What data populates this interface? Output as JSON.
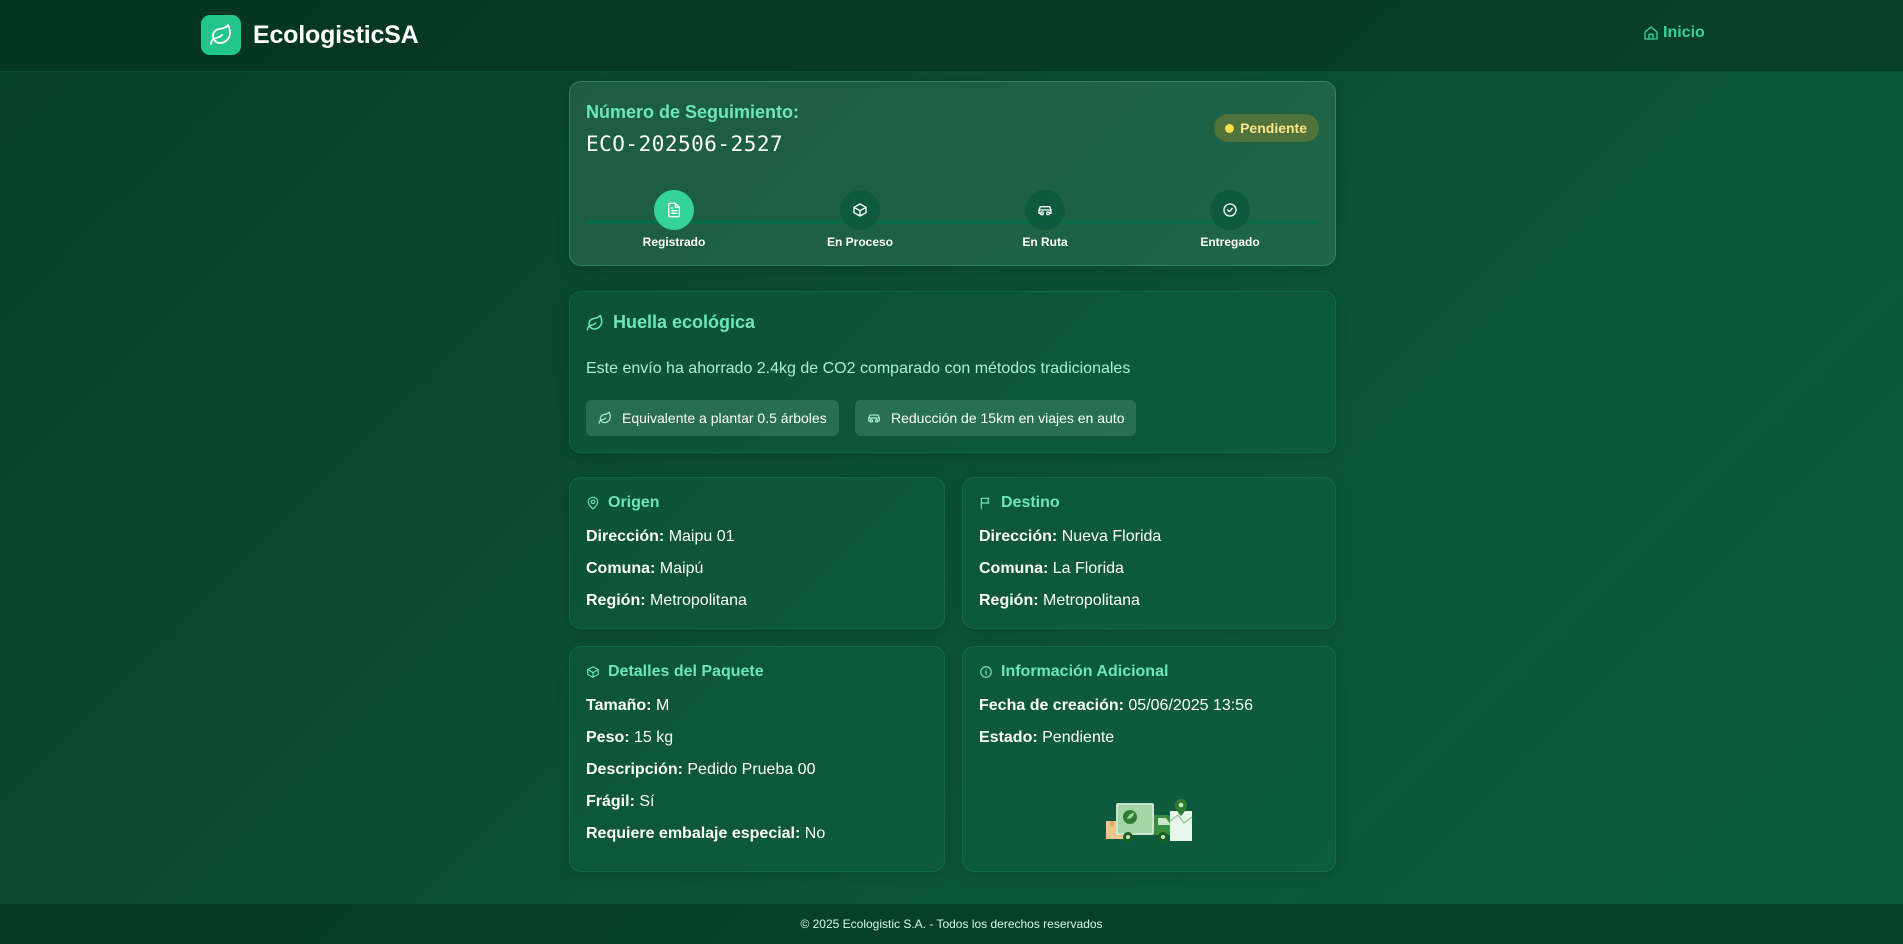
{
  "app": {
    "brand_name": "EcologisticSA",
    "logo_icon": "leaf-icon"
  },
  "nav": {
    "home_label": "Inicio",
    "home_icon": "home-icon"
  },
  "tracking": {
    "label": "Número de Seguimiento:",
    "number": "ECO-202506-2527",
    "status": "Pendiente",
    "status_color": "#fde047",
    "steps": [
      {
        "label": "Registrado",
        "icon": "document-icon",
        "active": true
      },
      {
        "label": "En Proceso",
        "icon": "box-icon",
        "active": false
      },
      {
        "label": "En Ruta",
        "icon": "car-icon",
        "active": false
      },
      {
        "label": "Entregado",
        "icon": "check-circle-icon",
        "active": false
      }
    ]
  },
  "eco": {
    "title": "Huella ecológica",
    "message": "Este envío ha ahorrado 2.4kg de CO2 comparado con métodos tradicionales",
    "chips": [
      {
        "label": "Equivalente a plantar 0.5 árboles",
        "icon": "leaf-icon"
      },
      {
        "label": "Reducción de 15km en viajes en auto",
        "icon": "car-icon"
      }
    ]
  },
  "origin": {
    "title": "Origen",
    "direccion_label": "Dirección:",
    "direccion": "Maipu 01",
    "comuna_label": "Comuna:",
    "comuna": "Maipú",
    "region_label": "Región:",
    "region": "Metropolitana"
  },
  "destination": {
    "title": "Destino",
    "direccion_label": "Dirección:",
    "direccion": "Nueva Florida",
    "comuna_label": "Comuna:",
    "comuna": "La Florida",
    "region_label": "Región:",
    "region": "Metropolitana"
  },
  "package": {
    "title": "Detalles del Paquete",
    "size_label": "Tamaño:",
    "size": "M",
    "weight_label": "Peso:",
    "weight": "15 kg",
    "desc_label": "Descripción:",
    "desc": "Pedido Prueba 00",
    "fragile_label": "Frágil:",
    "fragile": "Sí",
    "packing_label": "Requiere embalaje especial:",
    "packing": "No"
  },
  "extra": {
    "title": "Información Adicional",
    "created_label": "Fecha de creación:",
    "created": "05/06/2025 13:56",
    "state_label": "Estado:",
    "state": "Pendiente"
  },
  "footer": {
    "text": "© 2025 Ecologistic S.A. - Todos los derechos reservados"
  },
  "colors": {
    "accent": "#34d399",
    "accent_light": "#6ee7b7",
    "status_badge": "#fde68a"
  }
}
